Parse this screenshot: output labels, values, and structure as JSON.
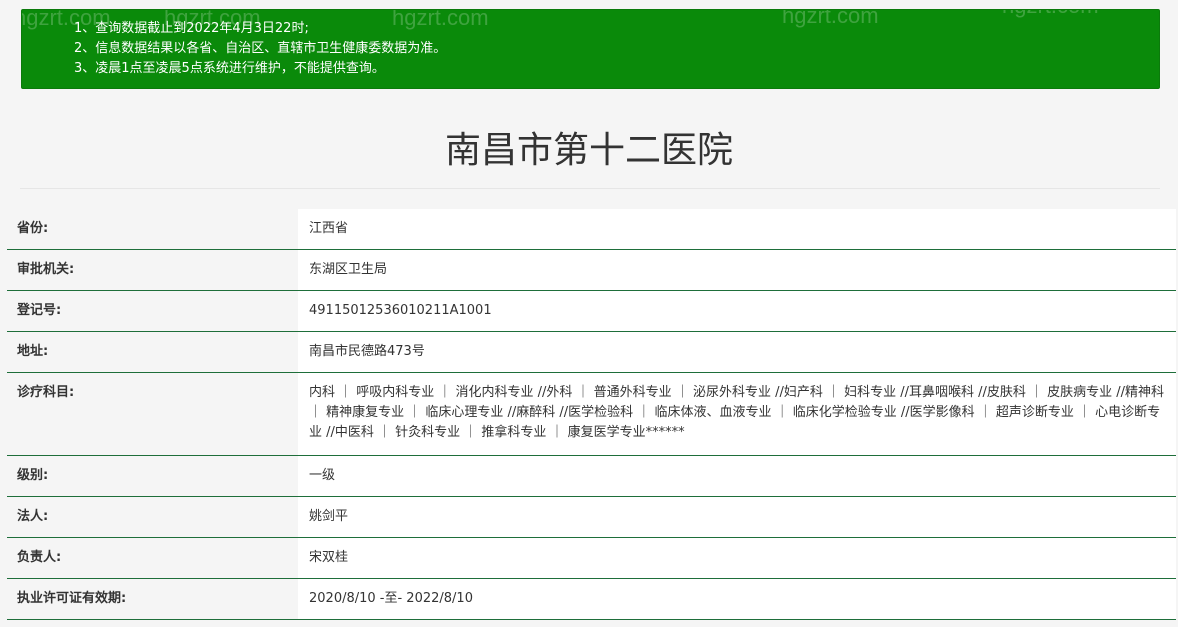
{
  "notice": {
    "lines": [
      "1、查询数据截止到2022年4月3日22时;",
      "2、信息数据结果以各省、自治区、直辖市卫生健康委数据为准。",
      "3、凌晨1点至凌晨5点系统进行维护，不能提供查询。"
    ],
    "watermark": "hgzrt.com",
    "background_color": "#0a8a0a"
  },
  "hospital": {
    "name": "南昌市第十二医院"
  },
  "fields": [
    {
      "label": "省份:",
      "value": "江西省"
    },
    {
      "label": "审批机关:",
      "value": "东湖区卫生局"
    },
    {
      "label": "登记号:",
      "value": "49115012536010211A1001"
    },
    {
      "label": "地址:",
      "value": "南昌市民德路473号"
    },
    {
      "label": "诊疗科目:",
      "value": "内科 ｜ 呼吸内科专业 ｜ 消化内科专业 //外科 ｜ 普通外科专业 ｜ 泌尿外科专业 //妇产科 ｜ 妇科专业 //耳鼻咽喉科 //皮肤科 ｜ 皮肤病专业 //精神科 ｜ 精神康复专业 ｜ 临床心理专业 //麻醉科 //医学检验科 ｜ 临床体液、血液专业 ｜ 临床化学检验专业 //医学影像科 ｜ 超声诊断专业 ｜ 心电诊断专业 //中医科 ｜ 针灸科专业 ｜ 推拿科专业 ｜ 康复医学专业******"
    },
    {
      "label": "级别:",
      "value": "一级"
    },
    {
      "label": "法人:",
      "value": "姚剑平"
    },
    {
      "label": "负责人:",
      "value": "宋双桂"
    },
    {
      "label": "执业许可证有效期:",
      "value": "2020/8/10 -至- 2022/8/10"
    }
  ],
  "colors": {
    "row_divider": "#1e6e3a",
    "label_bg": "#f5f5f5",
    "value_bg": "#ffffff"
  }
}
